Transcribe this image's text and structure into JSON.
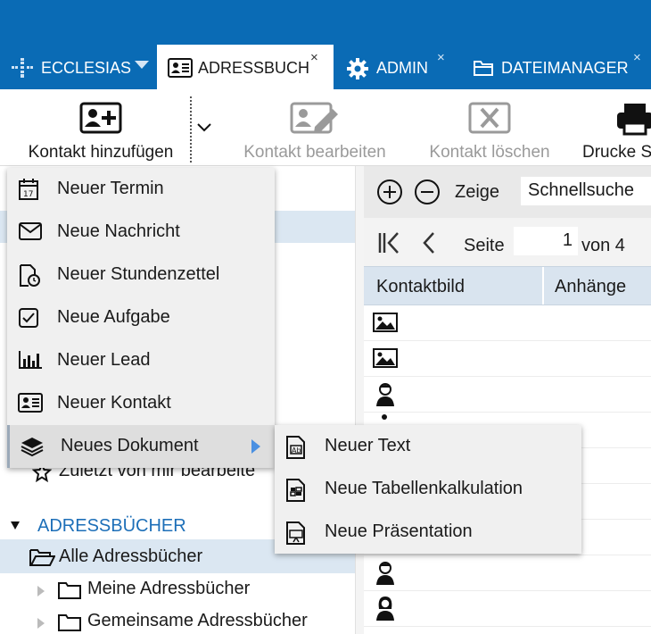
{
  "tabs": [
    {
      "label": "ECCLESIAS",
      "icon": "ecclesias-cross-icon",
      "close": ""
    },
    {
      "label": "ADRESSBUCH",
      "icon": "contact-card-icon",
      "close": "×"
    },
    {
      "label": "ADMIN",
      "icon": "gear-icon",
      "close": "×"
    },
    {
      "label": "DATEIMANAGER",
      "icon": "folder-icon",
      "close": "×"
    }
  ],
  "toolbar": {
    "add_contact": "Kontakt hinzufügen",
    "edit_contact": "Kontakt bearbeiten",
    "delete_contact": "Kontakt löschen",
    "print": "Drucke S"
  },
  "new_menu": {
    "items": [
      {
        "label": "Neuer Termin",
        "icon": "calendar-icon"
      },
      {
        "label": "Neue Nachricht",
        "icon": "envelope-icon"
      },
      {
        "label": "Neuer Stundenzettel",
        "icon": "timesheet-icon"
      },
      {
        "label": "Neue Aufgabe",
        "icon": "task-check-icon"
      },
      {
        "label": "Neuer Lead",
        "icon": "bar-chart-icon"
      },
      {
        "label": "Neuer Kontakt",
        "icon": "contact-card-icon"
      },
      {
        "label": "Neues Dokument",
        "icon": "layers-icon"
      }
    ]
  },
  "doc_submenu": {
    "items": [
      {
        "label": "Neuer Text",
        "icon": "text-document-icon"
      },
      {
        "label": "Neue Tabellenkalkulation",
        "icon": "spreadsheet-icon"
      },
      {
        "label": "Neue Präsentation",
        "icon": "presentation-icon"
      }
    ]
  },
  "left_tree": {
    "recent_edit": "Zuletzt von mir bearbeite",
    "section_title": "ADRESSBÜCHER",
    "all_books": "Alle Adressbücher",
    "my_books": "Meine Adressbücher",
    "shared_books": "Gemeinsame Adressbücher"
  },
  "right": {
    "show_label": "Zeige",
    "search_value": "Schnellsuche",
    "page_label": "Seite",
    "page_value": "1",
    "page_of": "von 4",
    "columns": [
      "Kontaktbild",
      "Anhänge"
    ]
  },
  "colors": {
    "topbar": "#0a6bb5",
    "section_title": "#1d6fb8",
    "selected_row": "#dbe7f2"
  }
}
